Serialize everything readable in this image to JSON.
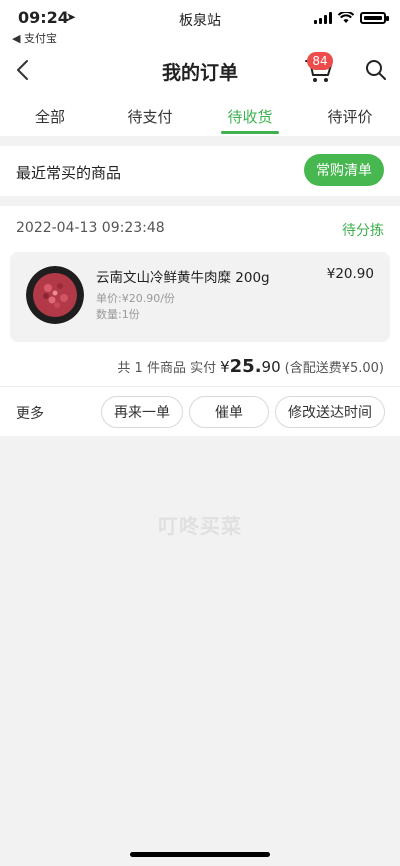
{
  "status_bar": {
    "time": "09:24",
    "back_app": "◀ 支付宝",
    "center": "板泉站"
  },
  "nav": {
    "title": "我的订单",
    "cart_badge": "84",
    "icons": [
      "back-icon",
      "cart-icon",
      "search-icon"
    ]
  },
  "tabs": [
    {
      "label": "全部",
      "active": false
    },
    {
      "label": "待支付",
      "active": false
    },
    {
      "label": "待收货",
      "active": true
    },
    {
      "label": "待评价",
      "active": false
    }
  ],
  "recent": {
    "label": "最近常买的商品",
    "button": "常购清单"
  },
  "order": {
    "time": "2022-04-13 09:23:48",
    "status": "待分拣",
    "product": {
      "name": "云南文山冷鲜黄牛肉糜 200g",
      "price": "¥20.90",
      "unit_price": "单价:¥20.90/份",
      "quantity": "数量:1份"
    },
    "total": {
      "prefix": "共 1 件商品 实付",
      "currency": "¥",
      "amount_int": "25.",
      "amount_dec": "90",
      "suffix": "(含配送费¥5.00)"
    },
    "more_label": "更多",
    "buttons": {
      "rebuy": "再来一单",
      "urge": "催单",
      "change_time": "修改送达时间"
    }
  },
  "watermark": "叮咚买菜",
  "colors": {
    "accent": "#3fb24f",
    "badge": "#ee4b4b"
  }
}
